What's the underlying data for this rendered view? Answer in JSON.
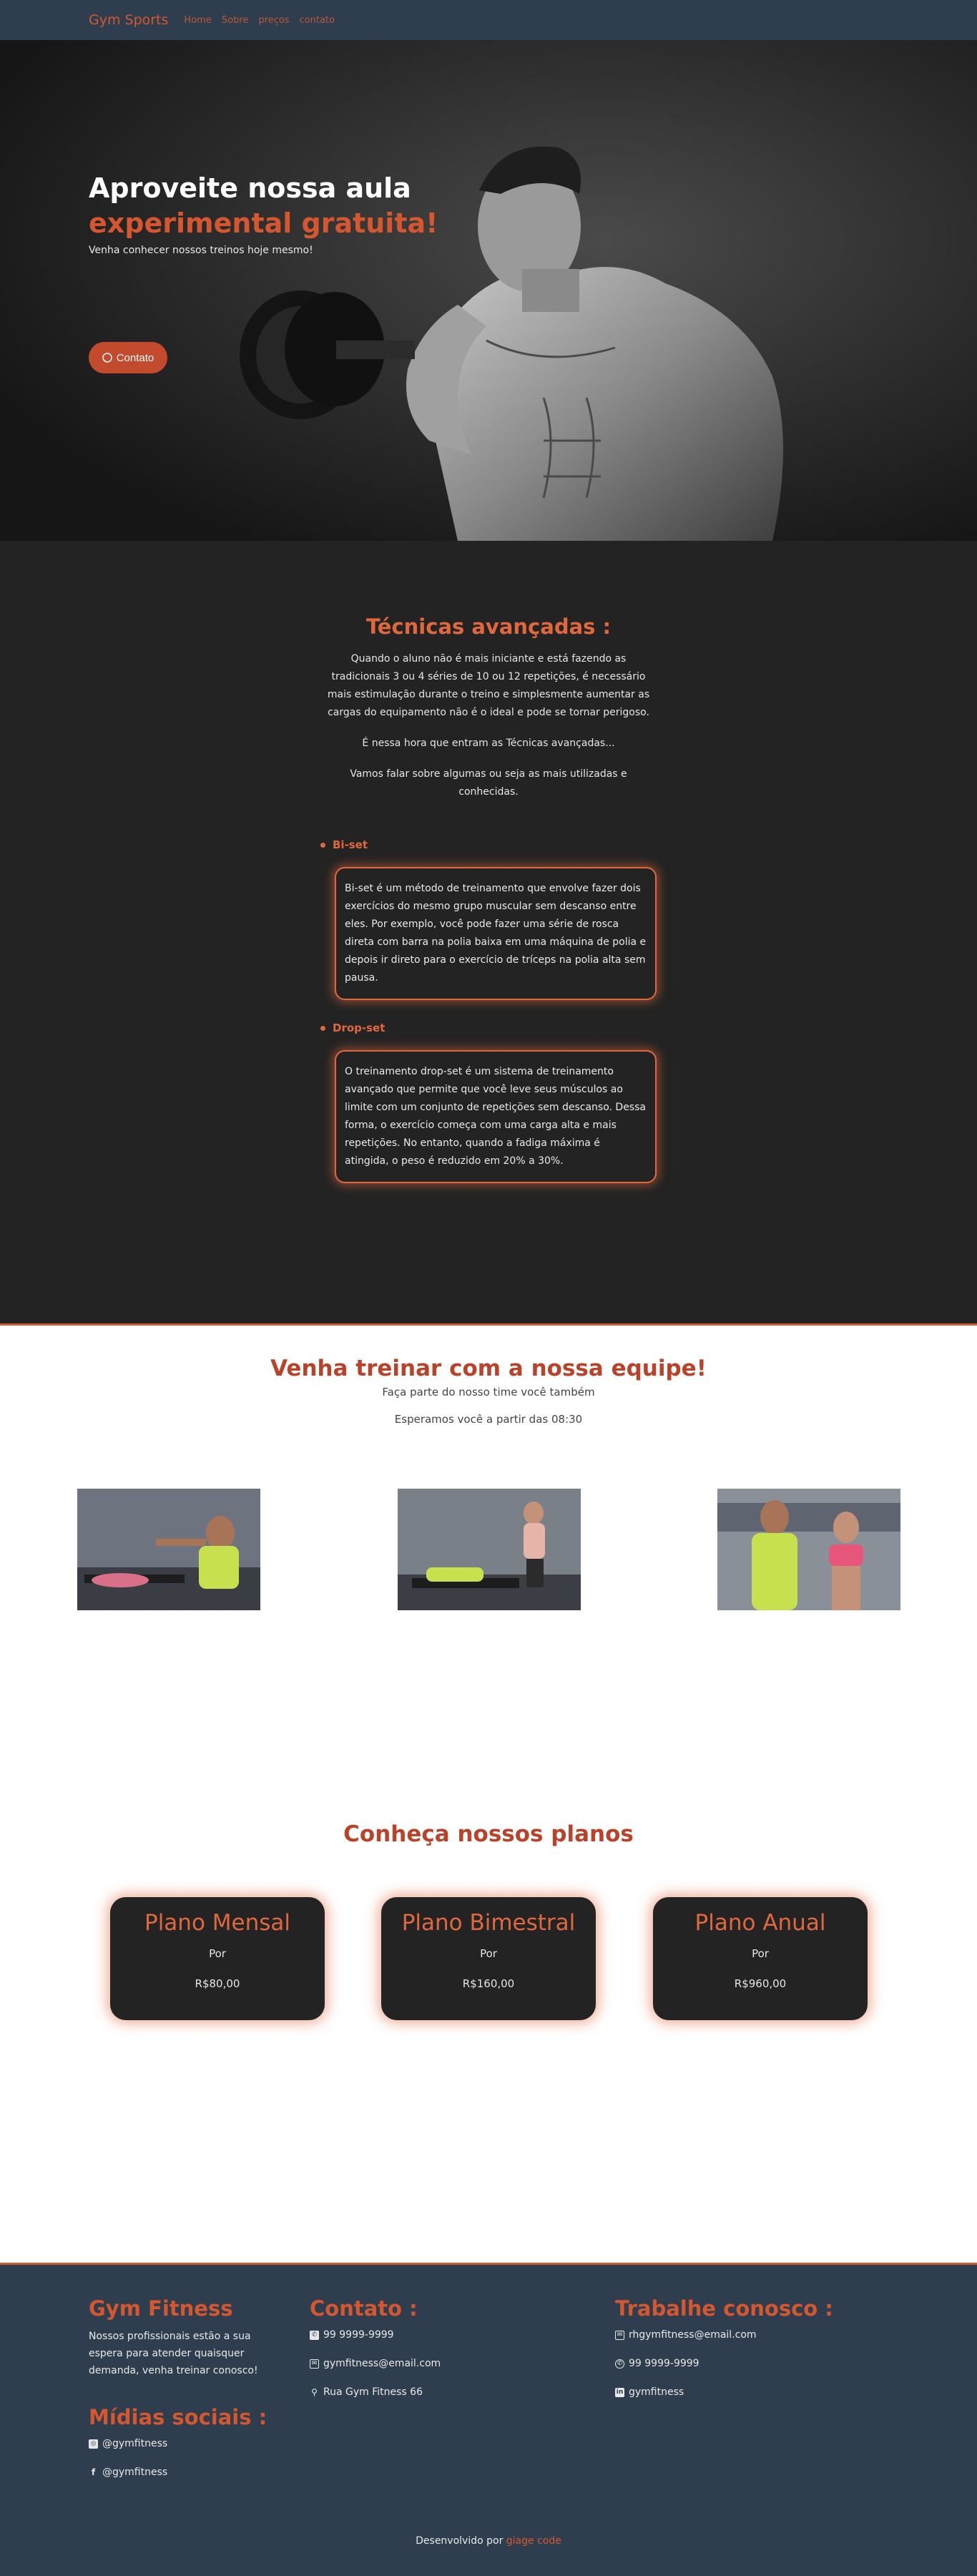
{
  "navbar": {
    "brand": "Gym Sports",
    "links": [
      "Home",
      "Sobre",
      "preços",
      "contato"
    ]
  },
  "hero": {
    "title_line1": "Aproveite nossa aula",
    "title_line2": "experimental gratuita!",
    "subtitle": "Venha conhecer nossos treinos hoje mesmo!",
    "button_label": "Contato",
    "button_icon": "whatsapp-icon"
  },
  "techniques": {
    "title": "Técnicas avançadas :",
    "paragraphs": [
      "Quando o aluno não é mais iniciante e está fazendo as tradicionais 3 ou 4 séries de 10 ou 12 repetições, é necessário mais estimulação durante o treino e simplesmente aumentar as cargas do equipamento não é o ideal e pode se tornar perigoso.",
      "É nessa hora que entram as Técnicas avançadas...",
      "Vamos falar sobre algumas ou seja as mais utilizadas e conhecidas."
    ],
    "items": [
      {
        "label": "Bi-set",
        "text": "Bi-set é um método de treinamento que envolve fazer dois exercícios do mesmo grupo muscular sem descanso entre eles. Por exemplo, você pode fazer uma série de rosca direta com barra na polia baixa em uma máquina de polia e depois ir direto para o exercício de tríceps na polia alta sem pausa."
      },
      {
        "label": "Drop-set",
        "text": "O treinamento drop-set é um sistema de treinamento avançado que permite que você leve seus músculos ao limite com um conjunto de repetições sem descanso. Dessa forma, o exercício começa com uma carga alta e mais repetições. No entanto, quando a fadiga máxima é atingida, o peso é reduzido em 20% a 30%."
      }
    ]
  },
  "team": {
    "title": "Venha treinar com a nossa equipe!",
    "line1": "Faça parte do nosso time você também",
    "line2": "Esperamos você a partir das 08:30"
  },
  "plans": {
    "title": "Conheça nossos planos",
    "items": [
      {
        "name": "Plano Mensal",
        "por": "Por",
        "price": "R$80,00"
      },
      {
        "name": "Plano Bimestral",
        "por": "Por",
        "price": "R$160,00"
      },
      {
        "name": "Plano Anual",
        "por": "Por",
        "price": "R$960,00"
      }
    ]
  },
  "footer": {
    "brand_title": "Gym Fitness",
    "brand_text": "Nossos profissionais estão a sua espera para atender quaisquer demanda, venha treinar conosco!",
    "social_title": "Mídias sociais :",
    "instagram": "@gymfitness",
    "facebook": "@gymfitness",
    "contact_title": "Contato :",
    "phone": "99 9999-9999",
    "email": "gymfitness@email.com",
    "address": "Rua Gym Fitness 66",
    "work_title": "Trabalhe conosco :",
    "work_email": "rhgymfitness@email.com",
    "work_whatsapp": "99 9999-9999",
    "work_linkedin": "gymfitness",
    "credits_prefix": "Desenvolvido por",
    "credits_link": "giage code"
  },
  "colors": {
    "accent": "#d4572f",
    "dark": "#232323",
    "navy": "#2f3e4e"
  }
}
